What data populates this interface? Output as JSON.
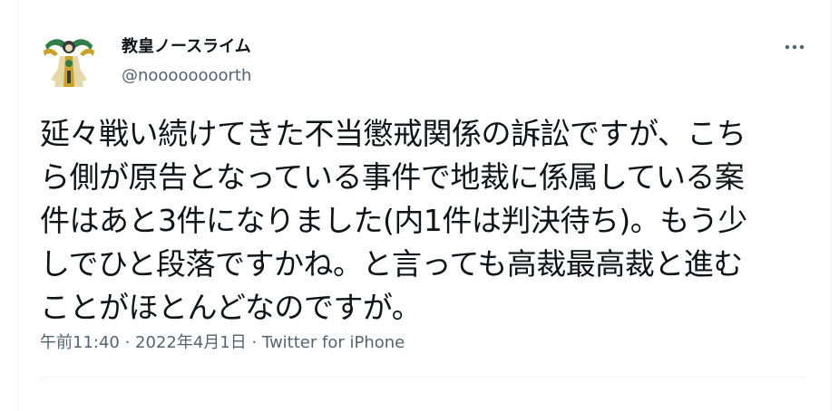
{
  "author": {
    "display_name": "教皇ノースライム",
    "handle": "@noooooooorth"
  },
  "tweet": {
    "lines": [
      "延々戦い続けてきた不当懲戒関係の訴訟ですが、こち",
      "ら側が原告となっている事件で地裁に係属している案",
      "件はあと3件になりました(内1件は判決待ち)。もう少",
      "しでひと段落ですかね。と言っても高裁最高裁と進む",
      "ことがほとんどなのですが。"
    ]
  },
  "meta": {
    "time": "午前11:40",
    "separator_1": " · ",
    "date": "2022年4月1日",
    "separator_2": " · ",
    "source": "Twitter for iPhone"
  },
  "icons": {
    "more": "more-horizontal-icon",
    "avatar": "avatar-image"
  },
  "colors": {
    "text": "#0f1419",
    "secondary": "#536471",
    "border": "#eff3f4"
  }
}
